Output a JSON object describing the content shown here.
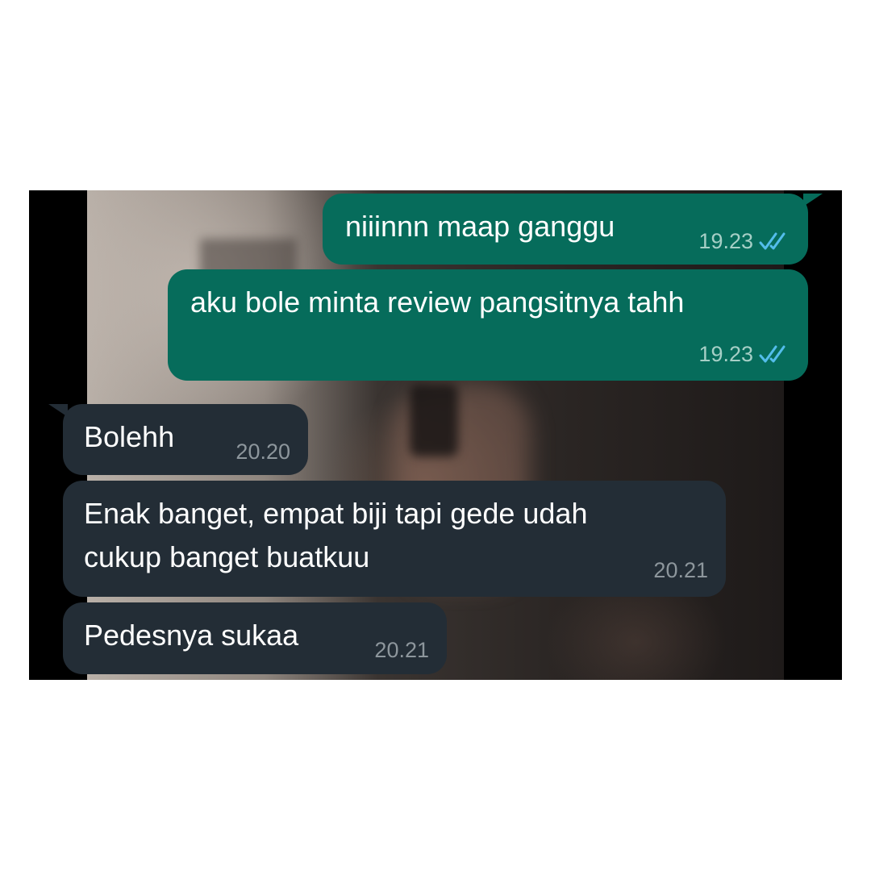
{
  "messages": [
    {
      "direction": "outgoing",
      "text": "niiinnn maap ganggu",
      "time": "19.23",
      "status_icon": "double-check-read-icon"
    },
    {
      "direction": "outgoing",
      "text": "aku bole minta review pangsitnya tahh",
      "time": "19.23",
      "status_icon": "double-check-read-icon"
    },
    {
      "direction": "incoming",
      "text": "Bolehh",
      "time": "20.20"
    },
    {
      "direction": "incoming",
      "lines": [
        "Enak banget, empat biji tapi gede udah",
        "cukup banget buatkuu"
      ],
      "time": "20.21"
    },
    {
      "direction": "incoming",
      "text": "Pedesnya sukaa",
      "time": "20.21"
    }
  ],
  "colors": {
    "outgoing_bubble": "#066c5b",
    "incoming_bubble": "#232d36",
    "read_ticks": "#53bdeb"
  }
}
